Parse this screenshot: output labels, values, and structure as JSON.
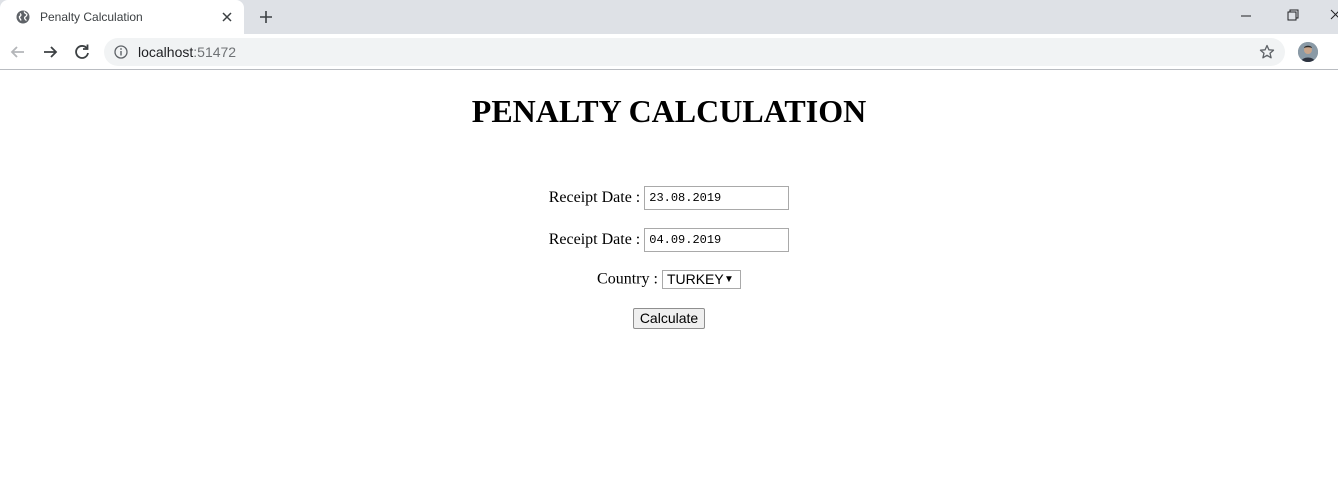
{
  "browser": {
    "tab": {
      "title": "Penalty Calculation"
    },
    "address": {
      "host": "localhost",
      "port": ":51472"
    }
  },
  "page": {
    "title": "PENALTY CALCULATION",
    "form": {
      "receipt_date_1": {
        "label": "Receipt Date :",
        "value": "23.08.2019"
      },
      "receipt_date_2": {
        "label": "Receipt Date :",
        "value": "04.09.2019"
      },
      "country": {
        "label": "Country :",
        "selected": "TURKEY"
      },
      "calculate_label": "Calculate"
    }
  },
  "colors": {
    "tabstrip_bg": "#dee1e6",
    "omnibox_bg": "#f1f3f4",
    "button_bg": "#efefef"
  }
}
